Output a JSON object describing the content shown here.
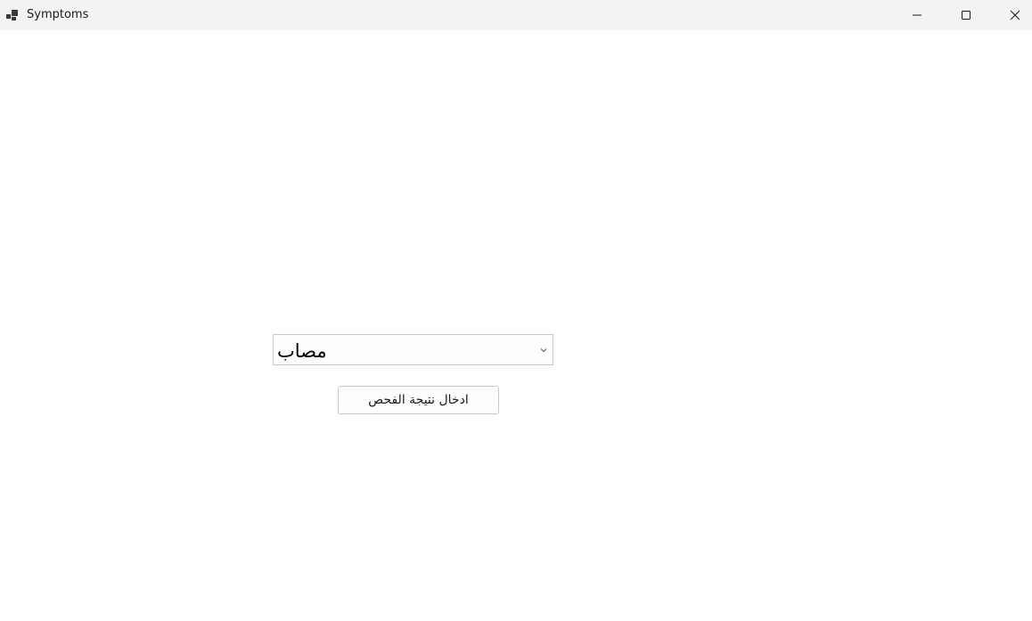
{
  "window": {
    "title": "Symptoms",
    "icons": {
      "app": "app-icon",
      "minimize": "minimize-icon",
      "maximize": "maximize-icon",
      "close": "close-icon"
    }
  },
  "form": {
    "status_select": {
      "selected_value": "مصاب",
      "icon": "chevron-down-icon"
    },
    "submit_button": {
      "label": "ادخال نتيجة الفحص"
    }
  }
}
